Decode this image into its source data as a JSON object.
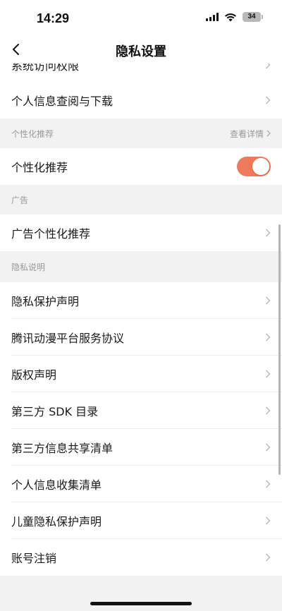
{
  "status_bar": {
    "time": "14:29",
    "battery": "34",
    "icons": [
      "signal-icon",
      "wifi-icon",
      "battery-icon"
    ]
  },
  "nav": {
    "title": "隐私设置",
    "back_icon": "chevron-left-icon"
  },
  "rows": {
    "system_permissions": "系统访问权限",
    "personal_info_download": "个人信息查阅与下载",
    "personalized_rec": "个性化推荐",
    "ad_personalized": "广告个性化推荐",
    "privacy_statement": "隐私保护声明",
    "service_agreement": "腾讯动漫平台服务协议",
    "copyright": "版权声明",
    "third_party_sdk": "第三方 SDK 目录",
    "third_party_share": "第三方信息共享清单",
    "personal_collect": "个人信息收集清单",
    "child_privacy": "儿童隐私保护声明",
    "account_cancel": "账号注销"
  },
  "sections": {
    "personalized": {
      "title": "个性化推荐",
      "link": "查看详情"
    },
    "ads": {
      "title": "广告"
    },
    "privacy": {
      "title": "隐私说明"
    }
  },
  "toggle": {
    "personalized_on": true
  },
  "colors": {
    "accent": "#ef7a5b",
    "background": "#f2f2f2",
    "card": "#ffffff",
    "section_text": "#999999"
  }
}
